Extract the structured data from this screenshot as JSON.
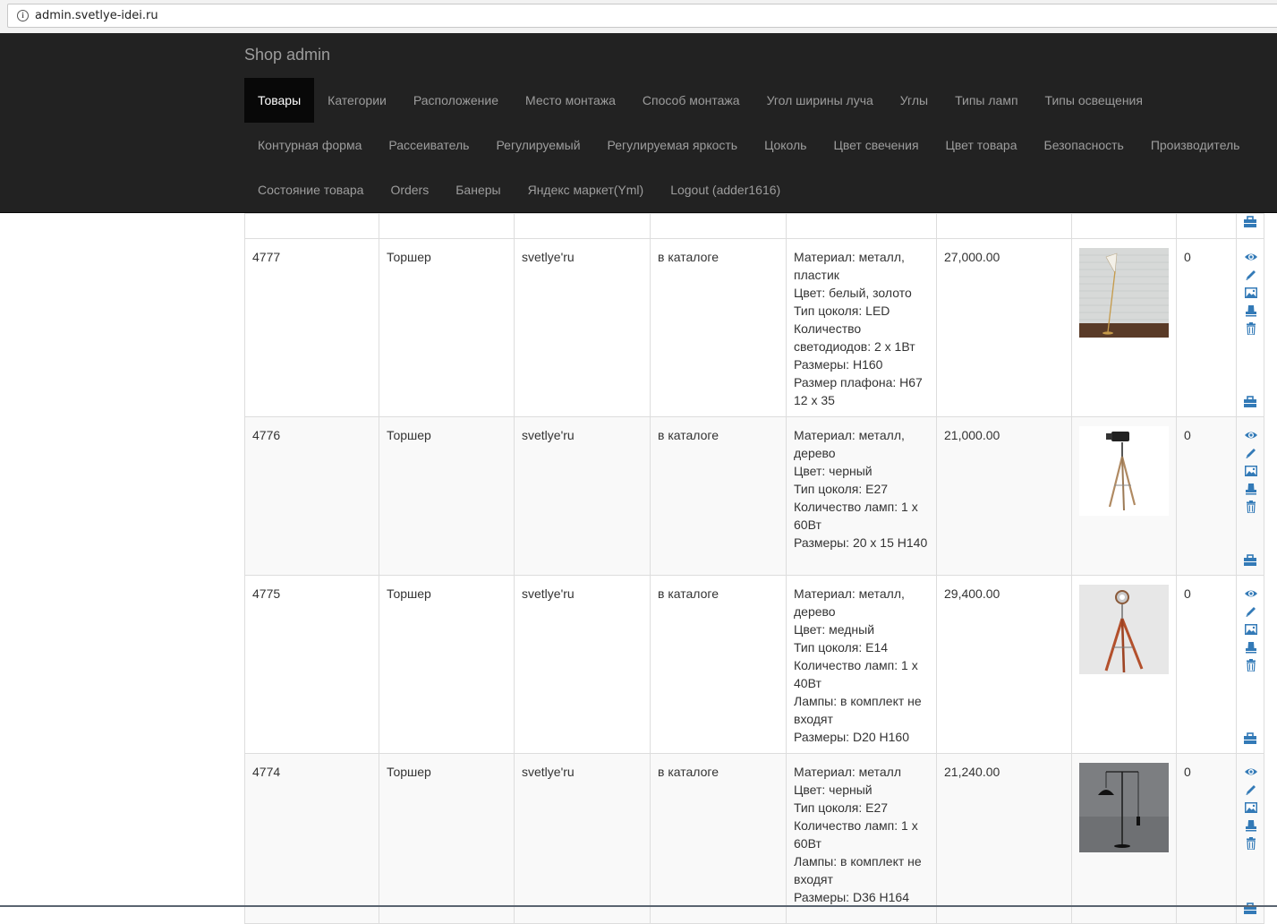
{
  "browser": {
    "url": "admin.svetlye-idei.ru"
  },
  "navbar": {
    "brand": "Shop admin",
    "items": [
      {
        "label": "Товары",
        "active": true
      },
      {
        "label": "Категории"
      },
      {
        "label": "Расположение"
      },
      {
        "label": "Место монтажа"
      },
      {
        "label": "Способ монтажа"
      },
      {
        "label": "Угол ширины луча"
      },
      {
        "label": "Углы"
      },
      {
        "label": "Типы ламп"
      },
      {
        "label": "Типы освещения"
      },
      {
        "label": "Контурная форма"
      },
      {
        "label": "Рассеиватель"
      },
      {
        "label": "Регулируемый"
      },
      {
        "label": "Регулируемая яркость"
      },
      {
        "label": "Цоколь"
      },
      {
        "label": "Цвет свечения"
      },
      {
        "label": "Цвет товара"
      },
      {
        "label": "Безопасность"
      },
      {
        "label": "Производитель"
      },
      {
        "label": "Состояние товара"
      },
      {
        "label": "Orders"
      },
      {
        "label": "Банеры"
      },
      {
        "label": "Яндекс маркет(Yml)"
      },
      {
        "label": "Logout (adder1616)"
      }
    ]
  },
  "rows": [
    {
      "id": "4777",
      "name": "Торшер",
      "brand": "svetlye'ru",
      "status": "в каталоге",
      "description": [
        "Материал: металл,",
        "пластик",
        "Цвет: белый, золото",
        "Тип цоколя: LED",
        "Количество",
        "светодиодов: 2 x 1Вт",
        "Размеры: H160",
        "Размер плафона: H67",
        "12 x 35"
      ],
      "price": "27,000.00",
      "qty": "0",
      "image": "floor-lamp-brick-wall"
    },
    {
      "id": "4776",
      "name": "Торшер",
      "brand": "svetlye'ru",
      "status": "в каталоге",
      "description": [
        "Материал: металл,",
        "дерево",
        "Цвет: черный",
        "Тип цоколя: E27",
        "Количество ламп: 1 x",
        "60Вт",
        "Размеры: 20 x 15 H140"
      ],
      "price": "21,000.00",
      "qty": "0",
      "image": "tripod-spotlight-black"
    },
    {
      "id": "4775",
      "name": "Торшер",
      "brand": "svetlye'ru",
      "status": "в каталоге",
      "description": [
        "Материал: металл,",
        "дерево",
        "Цвет: медный",
        "Тип цоколя: E14",
        "Количество ламп: 1 x",
        "40Вт",
        "Лампы: в комплект не",
        "входят",
        "Размеры: D20 H160"
      ],
      "price": "29,400.00",
      "qty": "0",
      "image": "tripod-spotlight-copper"
    },
    {
      "id": "4774",
      "name": "Торшер",
      "brand": "svetlye'ru",
      "status": "в каталоге",
      "description": [
        "Материал: металл",
        "Цвет: черный",
        "Тип цоколя: E27",
        "Количество ламп: 1 x",
        "60Вт",
        "Лампы: в комплект не",
        "входят",
        "Размеры: D36 H164"
      ],
      "price": "21,240.00",
      "qty": "0",
      "image": "arc-pendant-floor-lamp"
    }
  ],
  "action_icons": [
    "eye-icon",
    "pencil-icon",
    "image-icon",
    "stamp-icon",
    "trash-icon",
    "briefcase-icon"
  ],
  "colors": {
    "navbar_bg": "#222222",
    "nav_active_bg": "#080808",
    "nav_text": "#9d9d9d",
    "icon_blue": "#337ab7"
  }
}
